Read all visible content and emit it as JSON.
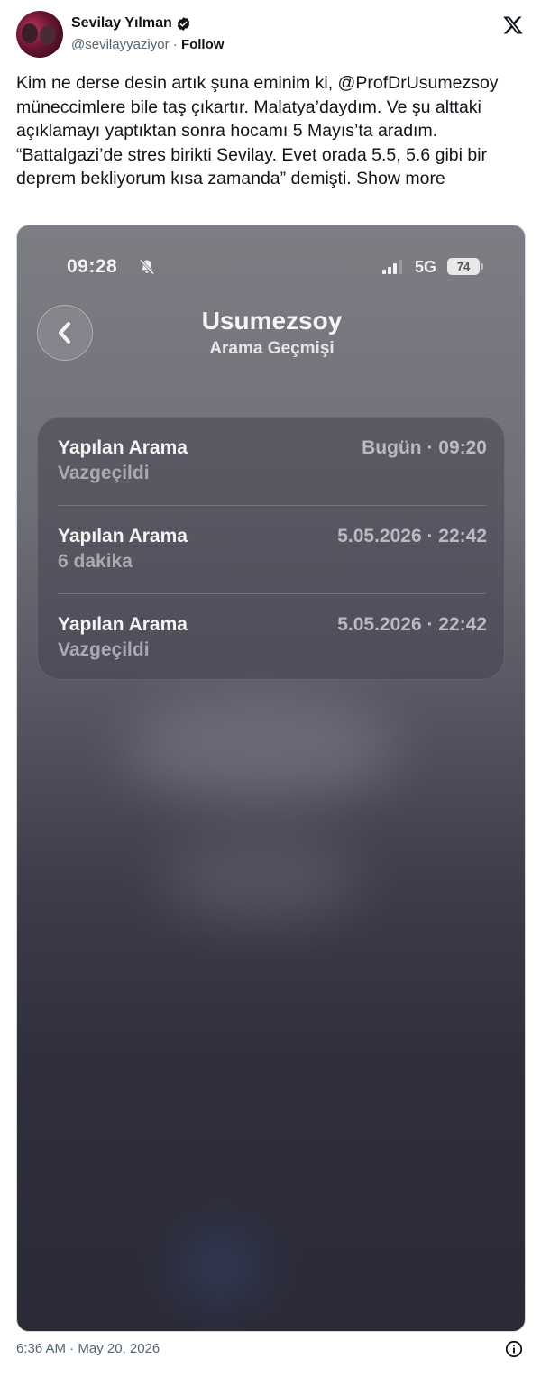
{
  "author": {
    "name": "Sevilay Yılman",
    "handle": "@sevilayyaziyor",
    "separator": " · ",
    "follow_label": "Follow"
  },
  "tweet": {
    "text": "Kim ne derse desin artık şuna eminim ki, @ProfDrUsumezsoy müneccimlere bile taş çıkartır. Malatya’daydım. Ve şu alttaki açıklamayı yaptıktan sonra hocamı 5 Mayıs’ta aradım. “Battalgazi’de stres birikti Sevilay. Evet orada 5.5, 5.6 gibi bir deprem bekliyorum kısa zamanda” demişti. ",
    "show_more": "Show more"
  },
  "phone": {
    "status_time": "09:28",
    "network": "5G",
    "battery": "74",
    "contact_name": "Usumezsoy",
    "subtitle": "Arama Geçmişi",
    "calls": [
      {
        "type": "Yapılan Arama",
        "detail": "Vazgeçildi",
        "date": "Bugün · 09:20"
      },
      {
        "type": "Yapılan Arama",
        "detail": "6 dakika",
        "date": "5.05.2026 · 22:42"
      },
      {
        "type": "Yapılan Arama",
        "detail": "Vazgeçildi",
        "date": "5.05.2026 · 22:42"
      }
    ]
  },
  "footer": {
    "timestamp": "6:36 AM · May 20, 2026"
  },
  "icons": {
    "verified": "verified-badge-icon",
    "brand": "x-logo-icon",
    "silent": "bell-slash-icon",
    "signal": "signal-bars-icon",
    "back": "chevron-left-icon",
    "info": "info-icon"
  },
  "colors": {
    "text": "#0f1419",
    "secondary": "#536471"
  }
}
